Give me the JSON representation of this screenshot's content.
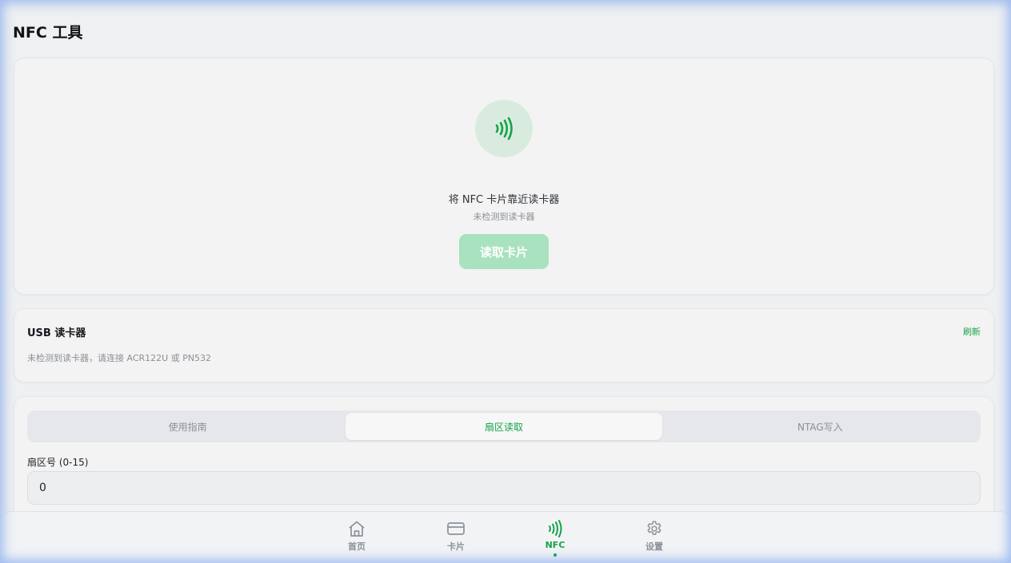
{
  "page": {
    "title": "NFC 工具"
  },
  "scan": {
    "icon": "nfc-signal-icon",
    "prompt": "将 NFC 卡片靠近读卡器",
    "status": "未检测到读卡器",
    "read_button": "读取卡片"
  },
  "usb": {
    "title": "USB 读卡器",
    "refresh": "刷新",
    "status": "未检测到读卡器，请连接 ACR122U 或 PN532"
  },
  "tools": {
    "tabs": [
      {
        "label": "使用指南",
        "active": false
      },
      {
        "label": "扇区读取",
        "active": true
      },
      {
        "label": "NTAG写入",
        "active": false
      }
    ],
    "sector_label": "扇区号 (0-15)",
    "sector_value": "0"
  },
  "nav": {
    "items": [
      {
        "label": "首页",
        "icon": "home-icon"
      },
      {
        "label": "卡片",
        "icon": "card-icon"
      },
      {
        "label": "NFC",
        "icon": "nfc-icon",
        "active": true
      },
      {
        "label": "设置",
        "icon": "settings-icon"
      }
    ]
  },
  "colors": {
    "accent": "#16a34a",
    "accent_light": "#a8e2bf",
    "icon_bg": "#d9ebdf",
    "frame_glow": "#5a8ceb"
  }
}
